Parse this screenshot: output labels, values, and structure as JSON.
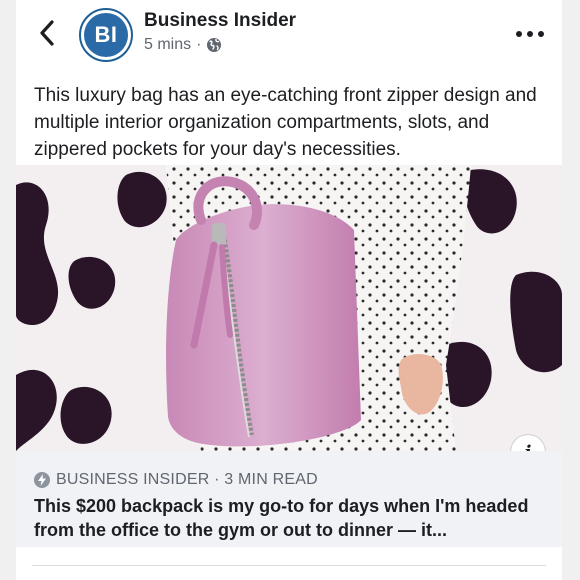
{
  "header": {
    "back_icon": "chevron-left-icon",
    "avatar_text": "BI",
    "page_name": "Business Insider",
    "timestamp": "5 mins",
    "separator": "·",
    "privacy_icon": "globe-icon",
    "more_icon": "more-horizontal-icon"
  },
  "post": {
    "text": "This luxury bag has an eye-catching front zipper design and multiple interior organization compartments, slots, and zippered pockets for your day's necessities.",
    "image_icon": "info-icon",
    "info_glyph": "i"
  },
  "link_preview": {
    "source_icon": "lightning-bolt-icon",
    "source": "BUSINESS INSIDER · 3 MIN READ",
    "headline": "This $200 backpack is my go-to for days when I'm headed from the office to the gym or out to dinner — it..."
  },
  "colors": {
    "brand_blue": "#2a6aa6",
    "text": "#1c1e21",
    "secondary_text": "#606770",
    "preview_bg": "#f0f2f5",
    "bag_pink": "#d8a3c9"
  }
}
